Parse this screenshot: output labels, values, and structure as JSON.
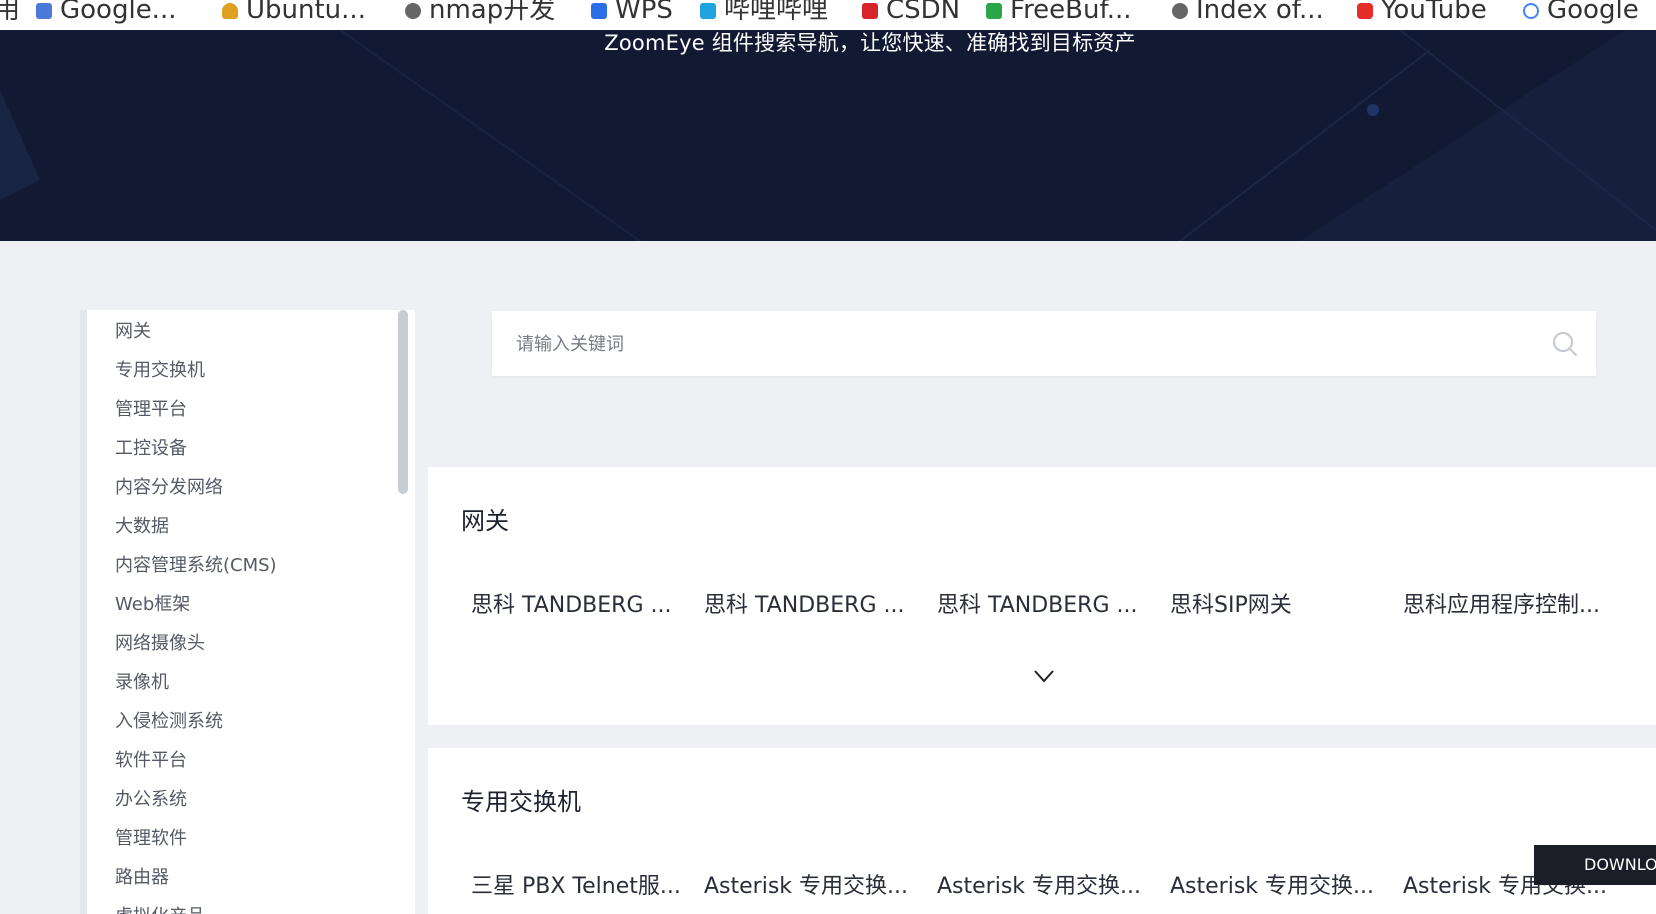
{
  "bookmarks": [
    {
      "label": "用",
      "icon": "bookmark-fragment-icon",
      "color": "#444444"
    },
    {
      "label": "Google...",
      "icon": "google-translate-icon",
      "color": "#4a7bd8"
    },
    {
      "label": "Ubuntu...",
      "icon": "tux-penguin-icon",
      "color": "#e0a020"
    },
    {
      "label": "nmap开发",
      "icon": "globe-icon",
      "color": "#666666"
    },
    {
      "label": "WPS",
      "icon": "wps-icon",
      "color": "#2a6ee8"
    },
    {
      "label": "哔哩哔哩",
      "icon": "bilibili-icon",
      "color": "#21a3de"
    },
    {
      "label": "CSDN",
      "icon": "csdn-icon",
      "color": "#d9232b"
    },
    {
      "label": "FreeBuf...",
      "icon": "freebuf-icon",
      "color": "#2ba64a"
    },
    {
      "label": "Index of...",
      "icon": "globe-icon",
      "color": "#666666"
    },
    {
      "label": "YouTube",
      "icon": "youtube-icon",
      "color": "#e52d27"
    },
    {
      "label": "Google",
      "icon": "google-icon",
      "color": "#4285f4"
    }
  ],
  "hero": {
    "subtitle": "ZoomEye 组件搜索导航，让您快速、准确找到目标资产",
    "background": "#121a33"
  },
  "sidebar": {
    "items": [
      "网关",
      "专用交换机",
      "管理平台",
      "工控设备",
      "内容分发网络",
      "大数据",
      "内容管理系统(CMS)",
      "Web框架",
      "网络摄像头",
      "录像机",
      "入侵检测系统",
      "软件平台",
      "办公系统",
      "管理软件",
      "路由器",
      "虚拟化产品"
    ]
  },
  "search": {
    "placeholder": "请输入关键词"
  },
  "sections": [
    {
      "title": "网关",
      "items": [
        "思科 TANDBERG ...",
        "思科 TANDBERG ...",
        "思科 TANDBERG ...",
        "思科SIP网关",
        "思科应用程序控制..."
      ]
    },
    {
      "title": "专用交换机",
      "items": [
        "三星 PBX Telnet服...",
        "Asterisk 专用交换...",
        "Asterisk 专用交换...",
        "Asterisk 专用交换...",
        "Asterisk 专用交换..."
      ]
    }
  ],
  "download": {
    "label": "DOWNLOAD"
  }
}
